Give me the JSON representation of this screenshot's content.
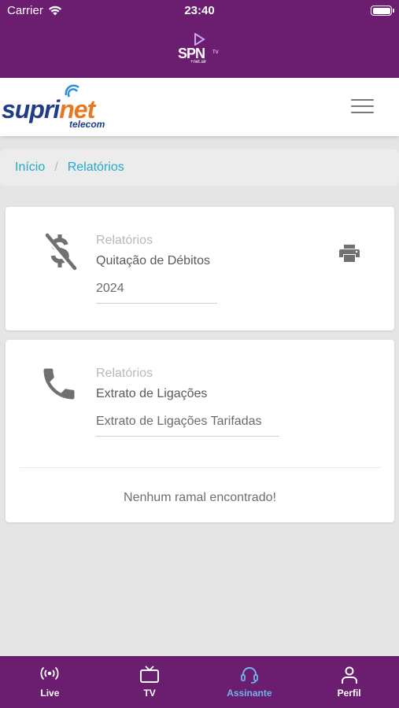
{
  "status_bar": {
    "carrier": "Carrier",
    "time": "23:40"
  },
  "app_logo": {
    "text": "SPN",
    "tv": "TV",
    "sub": "+net.air"
  },
  "brand": {
    "name_part1": "supri",
    "name_part2": "net",
    "sub": "telecom"
  },
  "breadcrumb": {
    "home": "Início",
    "separator": "/",
    "current": "Relatórios"
  },
  "cards": [
    {
      "label": "Relatórios",
      "title": "Quitação de Débitos",
      "select_value": "2024",
      "icon": "dollar-off-icon",
      "action_icon": "print-icon"
    },
    {
      "label": "Relatórios",
      "title": "Extrato de Ligações",
      "select_value": "Extrato de Ligações Tarifadas",
      "icon": "phone-icon",
      "empty_message": "Nenhum ramal encontrado!"
    }
  ],
  "tabs": [
    {
      "label": "Live",
      "icon": "live-broadcast-icon",
      "active": false
    },
    {
      "label": "TV",
      "icon": "tv-icon",
      "active": false
    },
    {
      "label": "Assinante",
      "icon": "headset-icon",
      "active": true
    },
    {
      "label": "Perfil",
      "icon": "person-icon",
      "active": false
    }
  ],
  "colors": {
    "primary": "#6b1e6f",
    "link": "#23a9c9",
    "active_tab": "#6fb4ee",
    "brand_blue": "#1f3c88",
    "brand_orange": "#e87722"
  }
}
